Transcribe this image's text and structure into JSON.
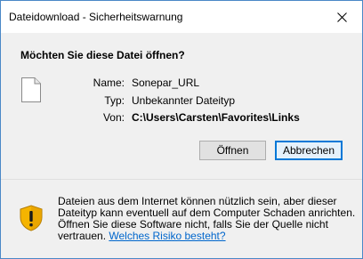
{
  "window": {
    "title": "Dateidownload - Sicherheitswarnung"
  },
  "dialog": {
    "question": "Möchten Sie diese Datei öffnen?",
    "fields": [
      {
        "label": "Name:",
        "value": "Sonepar_URL"
      },
      {
        "label": "Typ:",
        "value": "Unbekannter Dateityp"
      },
      {
        "label": "Von:",
        "value": "C:\\Users\\Carsten\\Favorites\\Links"
      }
    ],
    "buttons": {
      "open": "Öffnen",
      "cancel": "Abbrechen"
    }
  },
  "warning": {
    "text": "Dateien aus dem Internet können nützlich sein, aber dieser Dateityp kann eventuell auf dem Computer Schaden anrichten. Öffnen Sie diese Software nicht, falls Sie der Quelle nicht vertrauen. ",
    "link": "Welches Risiko besteht?"
  },
  "icons": {
    "file": "file-icon",
    "warning": "shield-warning-icon",
    "close": "close-icon"
  },
  "colors": {
    "accent": "#0078d7",
    "link": "#0066cc",
    "shield": "#f5b400"
  }
}
